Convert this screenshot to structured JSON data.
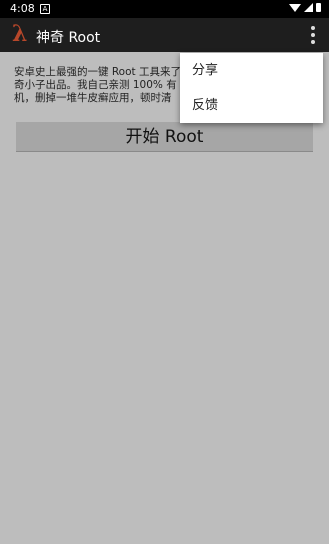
{
  "status_bar": {
    "time": "4:08",
    "notif_glyph": "A"
  },
  "app_bar": {
    "title": "神奇 Root",
    "logo_glyph": "λ"
  },
  "main": {
    "description_line1": "安卓史上最强的一键 Root 工具来了",
    "description_line2": "奇小子出品。我自己亲测 100% 有",
    "description_line3": "机，删掉一堆牛皮癣应用，顿时清",
    "start_button": "开始 Root"
  },
  "menu": {
    "items": [
      "分享",
      "反馈"
    ]
  },
  "colors": {
    "accent": "#b7472a",
    "background": "#bdbdbd",
    "app_bar": "#1e1e1e"
  }
}
